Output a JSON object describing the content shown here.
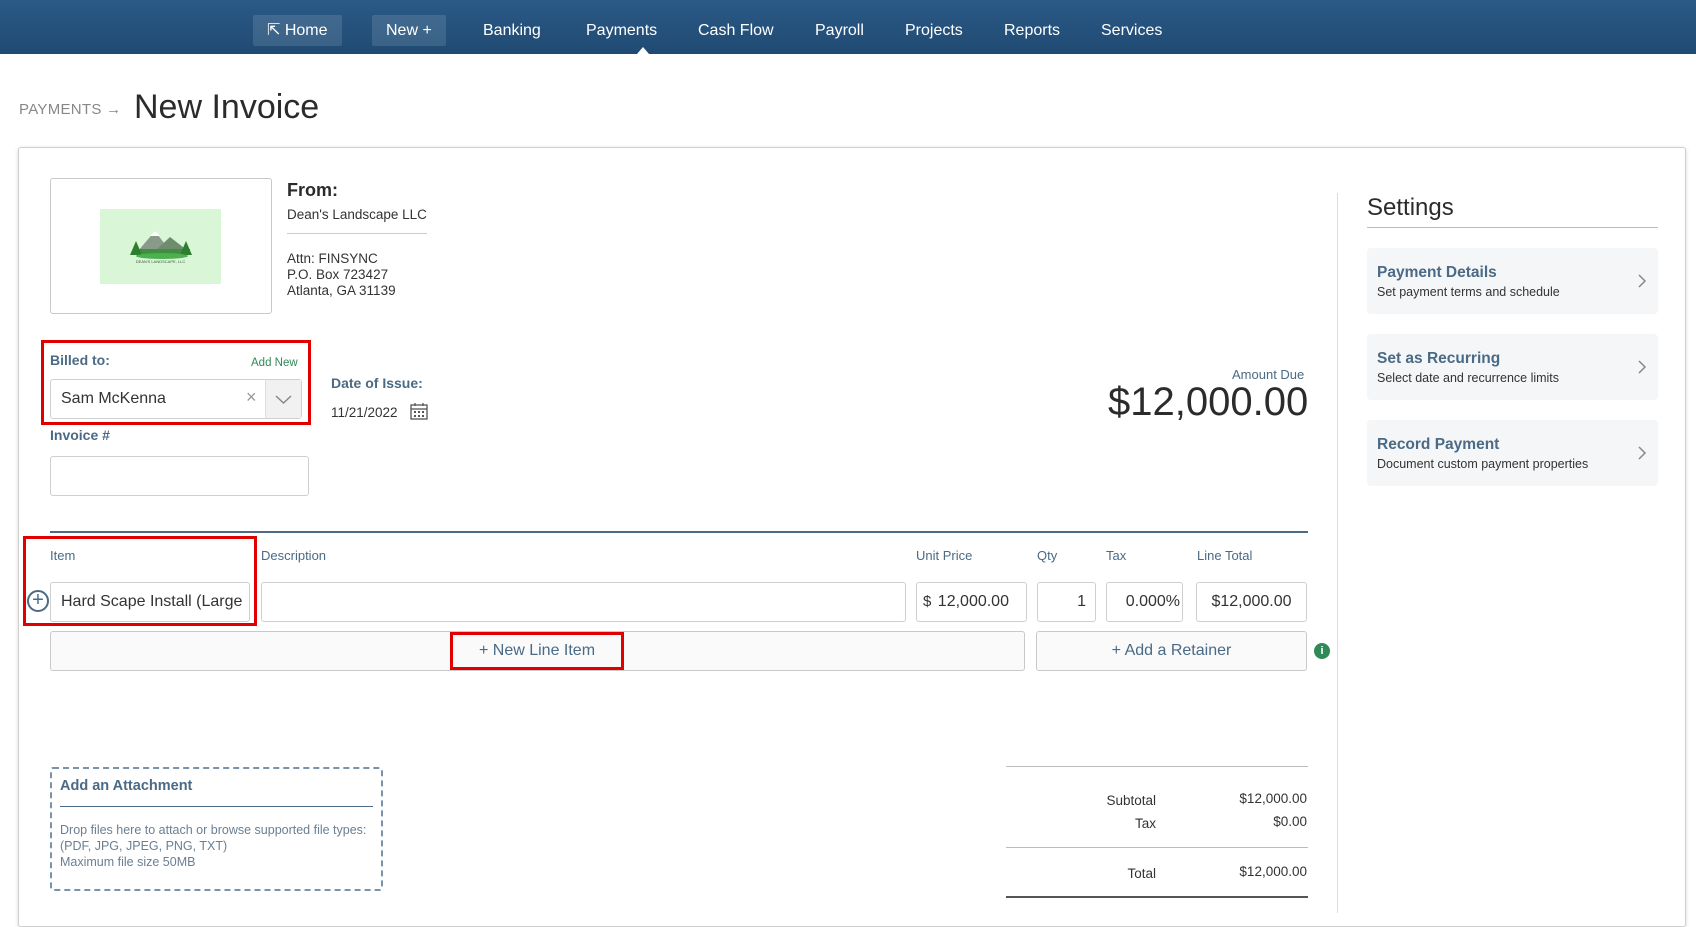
{
  "nav": {
    "items": [
      {
        "label": "⇱ Home"
      },
      {
        "label": "New +"
      },
      {
        "label": "Banking"
      },
      {
        "label": "Payments"
      },
      {
        "label": "Cash Flow"
      },
      {
        "label": "Payroll"
      },
      {
        "label": "Projects"
      },
      {
        "label": "Reports"
      },
      {
        "label": "Services"
      }
    ],
    "active": "Payments"
  },
  "breadcrumb": {
    "parent": "PAYMENTS",
    "arrow": "→"
  },
  "page": {
    "title": "New Invoice"
  },
  "from": {
    "title": "From:",
    "company": "Dean's Landscape LLC",
    "attn": "Attn: FINSYNC",
    "address1": "P.O. Box 723427",
    "address2": "Atlanta, GA 31139",
    "logo_text": "DEAN'S LANDSCAPE, LLC"
  },
  "billed_to": {
    "label": "Billed to:",
    "add_new": "Add New",
    "value": "Sam McKenna",
    "clear": "×"
  },
  "invoice_number": {
    "label": "Invoice #",
    "value": ""
  },
  "date_of_issue": {
    "label": "Date of Issue:",
    "value": "11/21/2022"
  },
  "amount_due": {
    "label": "Amount Due",
    "value": "$12,000.00"
  },
  "line_items": {
    "headers": {
      "item": "Item",
      "description": "Description",
      "unit_price": "Unit Price",
      "qty": "Qty",
      "tax": "Tax",
      "line_total": "Line Total"
    },
    "rows": [
      {
        "item": "Hard Scape Install (Large",
        "description": "",
        "currency_symbol": "$",
        "unit_price": "12,000.00",
        "qty": "1",
        "tax": "0.000%",
        "line_total": "$12,000.00"
      }
    ],
    "new_line_item": "+ New Line Item",
    "add_retainer": "+ Add a Retainer",
    "info": "i"
  },
  "attachment": {
    "title": "Add an Attachment",
    "text1": "Drop files here to attach or browse supported file types: (PDF, JPG, JPEG, PNG, TXT)",
    "text2": "Maximum file size 50MB"
  },
  "totals": {
    "subtotal_label": "Subtotal",
    "subtotal": "$12,000.00",
    "tax_label": "Tax",
    "tax": "$0.00",
    "total_label": "Total",
    "total": "$12,000.00"
  },
  "settings": {
    "title": "Settings",
    "cards": [
      {
        "title": "Payment Details",
        "subtitle": "Set payment terms and schedule"
      },
      {
        "title": "Set as Recurring",
        "subtitle": "Select date and recurrence limits"
      },
      {
        "title": "Record Payment",
        "subtitle": "Document custom payment properties"
      }
    ]
  },
  "colors": {
    "nav_bg": "#24507a",
    "accent": "#4a6a85",
    "highlight": "#e00000",
    "link_green": "#2e8b57"
  }
}
